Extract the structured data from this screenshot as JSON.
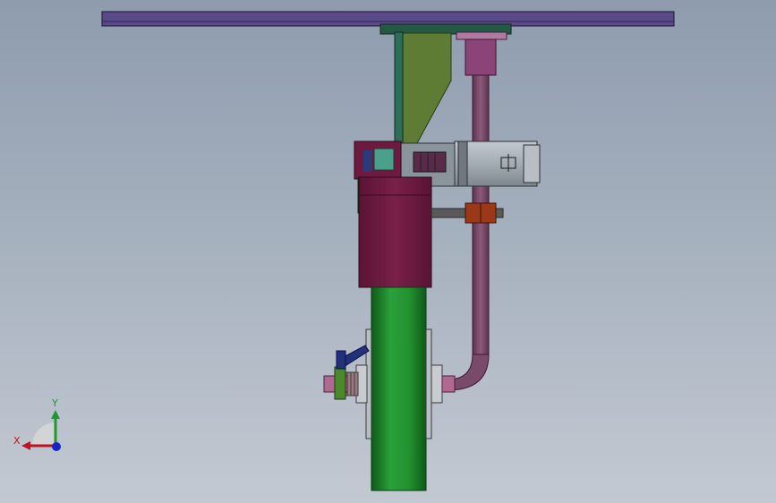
{
  "triad": {
    "x_label": "X",
    "y_label": "Y",
    "x_color": "#c0141c",
    "y_color": "#1a9a2a",
    "z_color": "#1525c8"
  },
  "colors": {
    "background_top": "#8e9cae",
    "background_bottom": "#c3c9d2",
    "top_beam": "#5a4a8a",
    "gusset": "#5f7c34",
    "upright": "#2e6e58",
    "pipe": "#7a4a6a",
    "pipe_coupling": "#8a4478",
    "housing": "#6e1a40",
    "wheel": "#1e8a2e",
    "motor": "#9aa4ac",
    "collar": "#9a3818",
    "shaft": "#5a5a5a",
    "axle": "#b06a90",
    "lever": "#23307a"
  }
}
